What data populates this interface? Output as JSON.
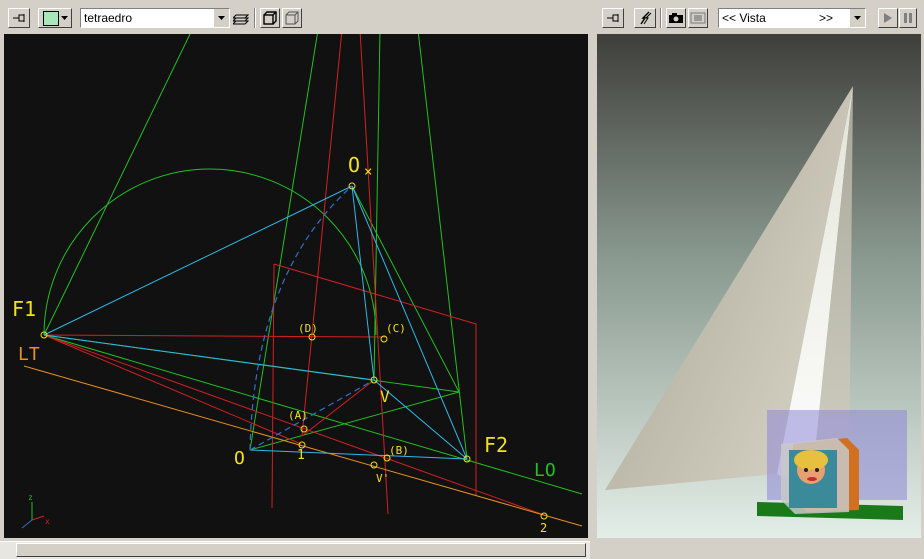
{
  "left_toolbar": {
    "object_select": "tetraedro",
    "fill_color": "#a8e8b8",
    "icons": [
      "pin-icon",
      "color-swatch-icon",
      "layers-icon",
      "wire-cube-icon",
      "solid-cube-icon"
    ]
  },
  "right_toolbar": {
    "view_select_prefix": "<< Vista",
    "view_select_suffix": ">>",
    "icons": [
      "pin-icon",
      "lightning-icon",
      "camera-icon",
      "film-icon",
      "play-icon",
      "pause-icon"
    ]
  },
  "drawing": {
    "labels": {
      "O_star": "O",
      "star_mark": "×",
      "F1": "F1",
      "F2": "F2",
      "LT": "LT",
      "LO": "LO",
      "D": "(D)",
      "C": "(C)",
      "V": "V",
      "A": "(A)",
      "B": "(B)",
      "O": "O",
      "one": "1",
      "Vp": "V'",
      "two": "2"
    },
    "axis_labels": {
      "z": "z",
      "x": "x"
    }
  },
  "colors": {
    "canvas_bg": "#111111",
    "green": "#22c022",
    "red": "#d42020",
    "cyan": "#30b8e8",
    "orange": "#e89020",
    "yellow": "#f0e020",
    "blue_dash": "#3070d0"
  }
}
